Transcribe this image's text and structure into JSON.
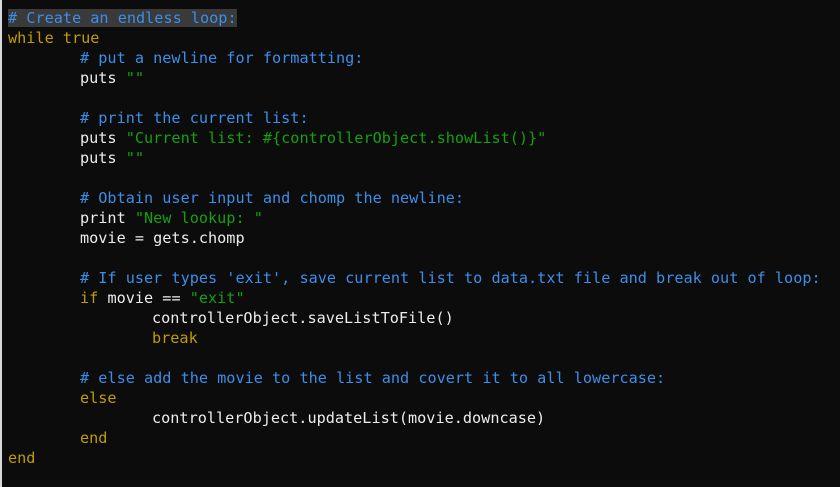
{
  "code": {
    "l1": {
      "comment": "# Create an endless loop:"
    },
    "l2": {
      "kw": "while",
      "rest": " true"
    },
    "l3": {
      "comment": "# put a newline for formatting:"
    },
    "l4": {
      "fn": "puts ",
      "str": "\"\""
    },
    "l6": {
      "comment": "# print the current list:"
    },
    "l7": {
      "fn": "puts ",
      "str": "\"Current list: #{controllerObject.showList()}\""
    },
    "l8": {
      "fn": "puts ",
      "str": "\"\""
    },
    "l10": {
      "comment": "# Obtain user input and chomp the newline:"
    },
    "l11": {
      "fn": "print ",
      "str": "\"New lookup: \""
    },
    "l12": {
      "text": "movie = gets.chomp"
    },
    "l14": {
      "comment": "# If user types 'exit', save current list to data.txt file and break out of loop:"
    },
    "l15": {
      "kw": "if",
      "mid": " movie == ",
      "str": "\"exit\""
    },
    "l16": {
      "text": "controllerObject.saveListToFile()"
    },
    "l17": {
      "kw": "break"
    },
    "l19": {
      "comment": "# else add the movie to the list and covert it to all lowercase:"
    },
    "l20": {
      "kw": "else"
    },
    "l21": {
      "text": "controllerObject.updateList(movie.downcase)"
    },
    "l22": {
      "kw": "end"
    },
    "l23": {
      "kw": "end"
    }
  },
  "colors": {
    "background": "#0c0c0c",
    "comment": "#3b8eea",
    "keyword": "#c19c00",
    "string": "#13a10e",
    "text": "#ececec"
  }
}
